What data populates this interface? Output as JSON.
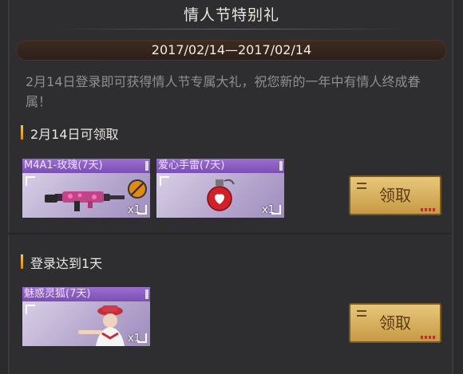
{
  "title": "情人节特别礼",
  "date_range": "2017/02/14—2017/02/14",
  "description": "2月14日登录即可获得情人节专属大礼，祝您新的一年中有情人终成眷属！",
  "sections": [
    {
      "title": "2月14日可领取",
      "items": [
        {
          "name": "M4A1-玫瑰(7天)",
          "qty": "x1",
          "icon": "rose-rifle-icon"
        },
        {
          "name": "爱心手雷(7天)",
          "qty": "x1",
          "icon": "heart-grenade-icon"
        }
      ],
      "button": "领取"
    },
    {
      "title": "登录达到1天",
      "items": [
        {
          "name": "魅惑灵狐(7天)",
          "qty": "x1",
          "icon": "character-icon"
        }
      ],
      "button": "领取"
    }
  ],
  "colors": {
    "accent": "#d98a1f",
    "item_header": "#8a5fc4",
    "button": "#d8b262"
  }
}
